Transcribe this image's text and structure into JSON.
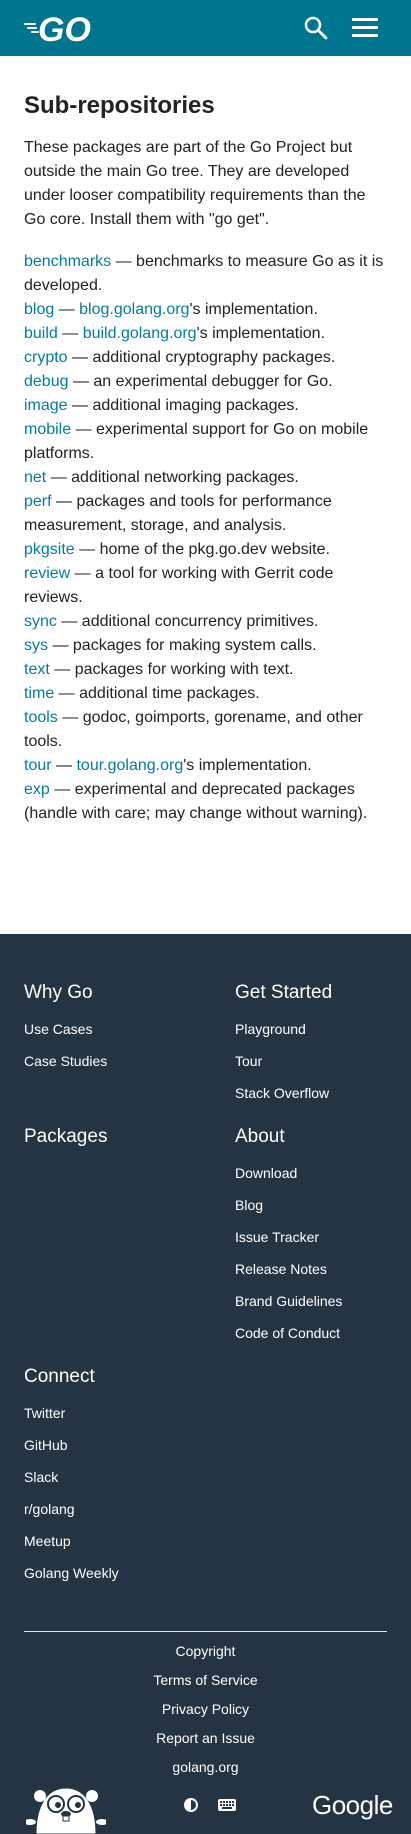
{
  "header": {
    "logo_text": "GO",
    "search_icon": "search-icon",
    "menu_icon": "hamburger-menu-icon"
  },
  "main": {
    "title": "Sub-repositories",
    "intro": "These packages are part of the Go Project but outside the main Go tree. They are developed under looser compatibility requirements than the Go core. Install them with \"go get\".",
    "packages": [
      {
        "name": "benchmarks",
        "desc": " — benchmarks to measure Go as it is developed."
      },
      {
        "name": "blog",
        "sep": " — ",
        "link": "blog.golang.org",
        "desc": "'s implementation."
      },
      {
        "name": "build",
        "sep": " — ",
        "link": "build.golang.org",
        "desc": "'s implementation."
      },
      {
        "name": "crypto",
        "desc": " — additional cryptography packages."
      },
      {
        "name": "debug",
        "desc": " — an experimental debugger for Go."
      },
      {
        "name": "image",
        "desc": " — additional imaging packages."
      },
      {
        "name": "mobile",
        "desc": " — experimental support for Go on mobile platforms."
      },
      {
        "name": "net",
        "desc": " — additional networking packages."
      },
      {
        "name": "perf",
        "desc": " — packages and tools for performance measurement, storage, and analysis."
      },
      {
        "name": "pkgsite",
        "desc": " — home of the pkg.go.dev website."
      },
      {
        "name": "review",
        "desc": " — a tool for working with Gerrit code reviews."
      },
      {
        "name": "sync",
        "desc": " — additional concurrency primitives."
      },
      {
        "name": "sys",
        "desc": " — packages for making system calls."
      },
      {
        "name": "text",
        "desc": " — packages for working with text."
      },
      {
        "name": "time",
        "desc": " — additional time packages."
      },
      {
        "name": "tools",
        "desc": " — godoc, goimports, gorename, and other tools."
      },
      {
        "name": "tour",
        "sep": " — ",
        "link": "tour.golang.org",
        "desc": "'s implementation."
      },
      {
        "name": "exp",
        "desc": " — experimental and deprecated packages (handle with care; may change without warning)."
      }
    ]
  },
  "footer": {
    "why_go": {
      "title": "Why Go",
      "links": [
        "Use Cases",
        "Case Studies"
      ]
    },
    "get_started": {
      "title": "Get Started",
      "links": [
        "Playground",
        "Tour",
        "Stack Overflow"
      ]
    },
    "packages": {
      "title": "Packages",
      "links": []
    },
    "about": {
      "title": "About",
      "links": [
        "Download",
        "Blog",
        "Issue Tracker",
        "Release Notes",
        "Brand Guidelines",
        "Code of Conduct"
      ]
    },
    "connect": {
      "title": "Connect",
      "links": [
        "Twitter",
        "GitHub",
        "Slack",
        "r/golang",
        "Meetup",
        "Golang Weekly"
      ]
    },
    "legal": [
      "Copyright",
      "Terms of Service",
      "Privacy Policy",
      "Report an Issue",
      "golang.org"
    ],
    "google_logo": "Google",
    "icons": {
      "theme": "theme-toggle-icon",
      "keyboard": "keyboard-icon",
      "gopher": "gopher-mascot-icon"
    }
  },
  "colors": {
    "header_bg": "#00758f",
    "link": "#007d9c",
    "footer_bg": "#253443",
    "text": "#202224"
  }
}
